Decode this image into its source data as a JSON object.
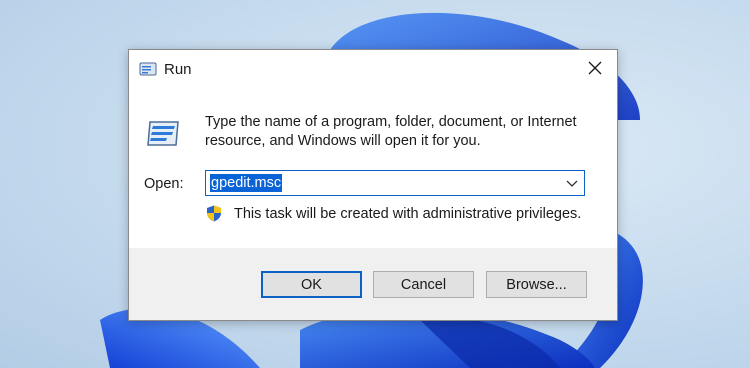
{
  "window": {
    "title": "Run",
    "description": "Type the name of a program, folder, document, or Internet resource, and Windows will open it for you.",
    "open_label": "Open:",
    "input_value": "gpedit.msc",
    "admin_note": "This task will be created with administrative privileges."
  },
  "buttons": {
    "ok": "OK",
    "cancel": "Cancel",
    "browse": "Browse..."
  },
  "icons": {
    "title": "run-icon",
    "big": "run-icon",
    "close": "close-icon",
    "dropdown": "chevron-down-icon",
    "shield": "uac-shield-icon"
  },
  "colors": {
    "accent": "#0b61c4",
    "selection": "#0a64d8",
    "footer": "#f0f0f0",
    "wallpaper_blue": "#1a56e0"
  }
}
